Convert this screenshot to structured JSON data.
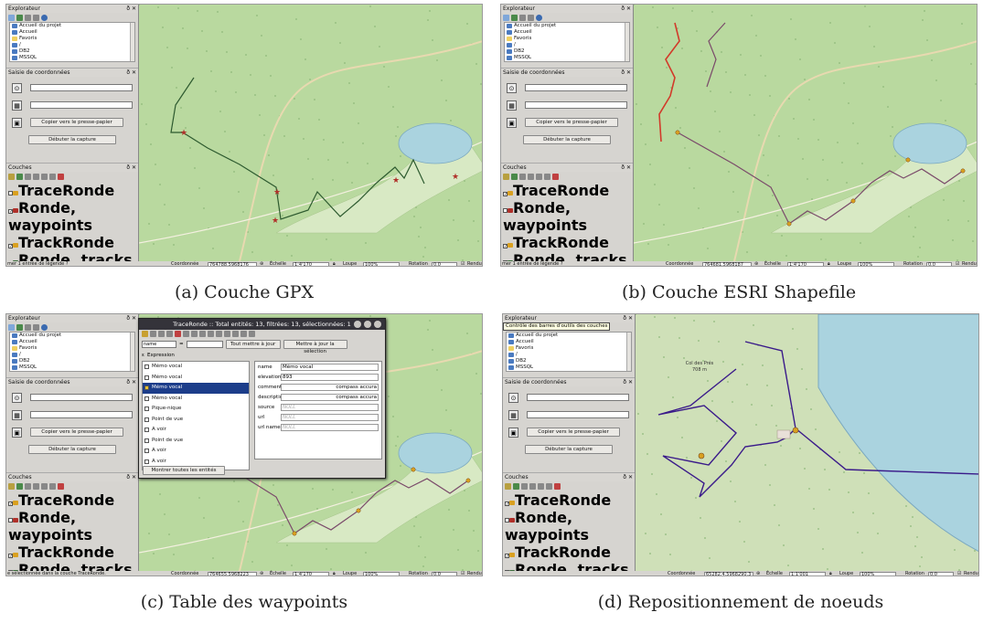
{
  "panels": [
    {
      "id": "a",
      "caption": "(a) Couche GPX",
      "explorer": {
        "title": "Explorateur",
        "items": [
          "Accueil du projet",
          "Accueil",
          "Favoris",
          "/",
          "DB2",
          "MSSQL"
        ]
      },
      "coords": {
        "title": "Saisie de coordonnées",
        "copy_label": "Copier vers le presse-papier",
        "capture_label": "Débuter la capture"
      },
      "layers": {
        "title": "Couches",
        "items": [
          {
            "label": "TraceRonde",
            "checked": false,
            "icon": "track-icon",
            "color": "#d9a020",
            "selected": false
          },
          {
            "label": "Ronde, waypoints",
            "checked": true,
            "icon": "star-icon",
            "color": "#b0302a",
            "selected": false
          },
          {
            "label": "TrackRonde",
            "checked": true,
            "icon": "track-icon",
            "color": "#d9a020",
            "selected": false
          },
          {
            "label": "Ronde, tracks",
            "checked": true,
            "icon": "line-icon",
            "color": "#3a6a3a",
            "selected": false
          },
          {
            "label": "OSM Standard",
            "checked": true,
            "icon": "osm-icon",
            "color": "#2e5da8",
            "selected": false
          }
        ]
      },
      "status": {
        "message": "mer 1 entrée de légende ?",
        "coord_label": "Coordonnée",
        "coord_value": "764788.5968176",
        "scale_label": "Échelle",
        "scale_value": "1:4'170",
        "zoom_label": "Loupe",
        "zoom_value": "100%",
        "rotation_label": "Rotation",
        "rotation_value": "0.0",
        "render_label": "Rendu"
      },
      "route_color": "#2d5a2f"
    },
    {
      "id": "b",
      "caption": "(b) Couche ESRI Shapefile",
      "explorer": {
        "title": "Explorateur",
        "items": [
          "Accueil du projet",
          "Accueil",
          "Favoris",
          "/",
          "DB2",
          "MSSQL"
        ]
      },
      "coords": {
        "title": "Saisie de coordonnées",
        "copy_label": "Copier vers le presse-papier",
        "capture_label": "Débuter la capture"
      },
      "layers": {
        "title": "Couches",
        "items": [
          {
            "label": "TraceRonde",
            "checked": true,
            "icon": "track-icon",
            "color": "#d9a020",
            "selected": false
          },
          {
            "label": "Ronde, waypoints",
            "checked": false,
            "icon": "star-icon",
            "color": "#b0302a",
            "selected": false
          },
          {
            "label": "TrackRonde",
            "checked": true,
            "icon": "track-icon",
            "color": "#d9a020",
            "selected": false
          },
          {
            "label": "Ronde, tracks",
            "checked": false,
            "icon": "line-icon",
            "color": "#3a6a3a",
            "selected": false
          },
          {
            "label": "OSM Standard",
            "checked": true,
            "icon": "osm-icon",
            "color": "#2e5da8",
            "selected": false
          }
        ]
      },
      "status": {
        "message": "mer 1 entrée de légende ?",
        "coord_label": "Coordonnée",
        "coord_value": "764681.5968187",
        "scale_label": "Échelle",
        "scale_value": "1:4'170",
        "zoom_label": "Loupe",
        "zoom_value": "100%",
        "rotation_label": "Rotation",
        "rotation_value": "0.0",
        "render_label": "Rendu"
      },
      "route_color": "#7a4a6a"
    },
    {
      "id": "c",
      "caption": "(c) Table des waypoints",
      "explorer": {
        "title": "Explorateur",
        "items": [
          "Accueil du projet",
          "Accueil",
          "Favoris",
          "/",
          "DB2",
          "MSSQL"
        ]
      },
      "coords": {
        "title": "Saisie de coordonnées",
        "copy_label": "Copier vers le presse-papier",
        "capture_label": "Débuter la capture"
      },
      "layers": {
        "title": "Couches",
        "items": [
          {
            "label": "TraceRonde",
            "checked": true,
            "icon": "track-icon",
            "color": "#d9a020",
            "selected": true
          },
          {
            "label": "Ronde, waypoints",
            "checked": false,
            "icon": "star-icon",
            "color": "#b0302a",
            "selected": false
          },
          {
            "label": "TrackRonde",
            "checked": true,
            "icon": "track-icon",
            "color": "#d9a020",
            "selected": false
          },
          {
            "label": "Ronde, tracks",
            "checked": false,
            "icon": "line-icon",
            "color": "#3a6a3a",
            "selected": false
          },
          {
            "label": "OSM Standard",
            "checked": true,
            "icon": "osm-icon",
            "color": "#2e5da8",
            "selected": false
          }
        ]
      },
      "status": {
        "message": "e sélectionnée dans la couche TraceRonde.",
        "coord_label": "Coordonnée",
        "coord_value": "764655.5968223",
        "scale_label": "Échelle",
        "scale_value": "1:4'170",
        "zoom_label": "Loupe",
        "zoom_value": "100%",
        "rotation_label": "Rotation",
        "rotation_value": "0.0",
        "render_label": "Rendu"
      },
      "route_color": "#7a4a6a"
    },
    {
      "id": "d",
      "caption": "(d) Repositionnement de noeuds",
      "tooltip": "Contrôle des barres d'outils des couches",
      "explorer": {
        "title": "Explorateur",
        "items": [
          "Accueil du projet",
          "Accueil",
          "Favoris",
          "/",
          "DB2",
          "MSSQL"
        ]
      },
      "coords": {
        "title": "Saisie de coordonnées",
        "copy_label": "Copier vers le presse-papier",
        "capture_label": "Débuter la capture"
      },
      "layers": {
        "title": "Couches",
        "items": [
          {
            "label": "TraceRonde",
            "checked": true,
            "icon": "track-icon",
            "color": "#d9a020",
            "selected": false
          },
          {
            "label": "Ronde, waypoints",
            "checked": false,
            "icon": "star-icon",
            "color": "#b0302a",
            "selected": false
          },
          {
            "label": "TrackRonde",
            "checked": true,
            "icon": "track-icon",
            "color": "#d9a020",
            "selected": true
          },
          {
            "label": "Ronde, tracks",
            "checked": false,
            "icon": "line-icon",
            "color": "#3a6a3a",
            "selected": false
          },
          {
            "label": "OSM Standard",
            "checked": true,
            "icon": "osm-icon",
            "color": "#2e5da8",
            "selected": false
          }
        ]
      },
      "status": {
        "message": "",
        "coord_label": "Coordonnée",
        "coord_value": "65282.4.5968290.3",
        "scale_label": "Échelle",
        "scale_value": "1:1'001",
        "zoom_label": "Loupe",
        "zoom_value": "100%",
        "rotation_label": "Rotation",
        "rotation_value": "0.0",
        "render_label": "Rendu"
      },
      "map_labels": {
        "summit_name": "Col des Prés",
        "summit_alt": "708 m"
      },
      "route_color": "#3a1a8a"
    }
  ],
  "attribute_table": {
    "title": "TraceRonde :: Total entités: 13, filtrées: 13, sélectionnées: 1",
    "field_select": "name",
    "update_all_label": "Tout mettre à jour",
    "update_selection_label": "Mettre à jour la sélection",
    "expression_label": "Expression",
    "rows": [
      {
        "label": "Mémo vocal",
        "selected": false
      },
      {
        "label": "Mémo vocal",
        "selected": false
      },
      {
        "label": "Mémo vocal",
        "selected": true
      },
      {
        "label": "Mémo vocal",
        "selected": false
      },
      {
        "label": "Pique-nique",
        "selected": false
      },
      {
        "label": "Point de vue",
        "selected": false
      },
      {
        "label": "A voir",
        "selected": false
      },
      {
        "label": "Point de vue",
        "selected": false
      },
      {
        "label": "A voir",
        "selected": false
      },
      {
        "label": "A voir",
        "selected": false
      }
    ],
    "form": [
      {
        "label": "name",
        "value": "Mémo vocal",
        "null": false,
        "right": false
      },
      {
        "label": "elevation",
        "value": "893",
        "null": false,
        "right": false
      },
      {
        "label": "comment",
        "value": "compass accura",
        "null": false,
        "right": true
      },
      {
        "label": "descriptio",
        "value": "compass accura",
        "null": false,
        "right": true
      },
      {
        "label": "source",
        "value": "NULL",
        "null": true,
        "right": false
      },
      {
        "label": "url",
        "value": "NULL",
        "null": true,
        "right": false
      },
      {
        "label": "url name",
        "value": "NULL",
        "null": true,
        "right": false
      }
    ],
    "show_all_label": "Montrer toutes les entités"
  }
}
